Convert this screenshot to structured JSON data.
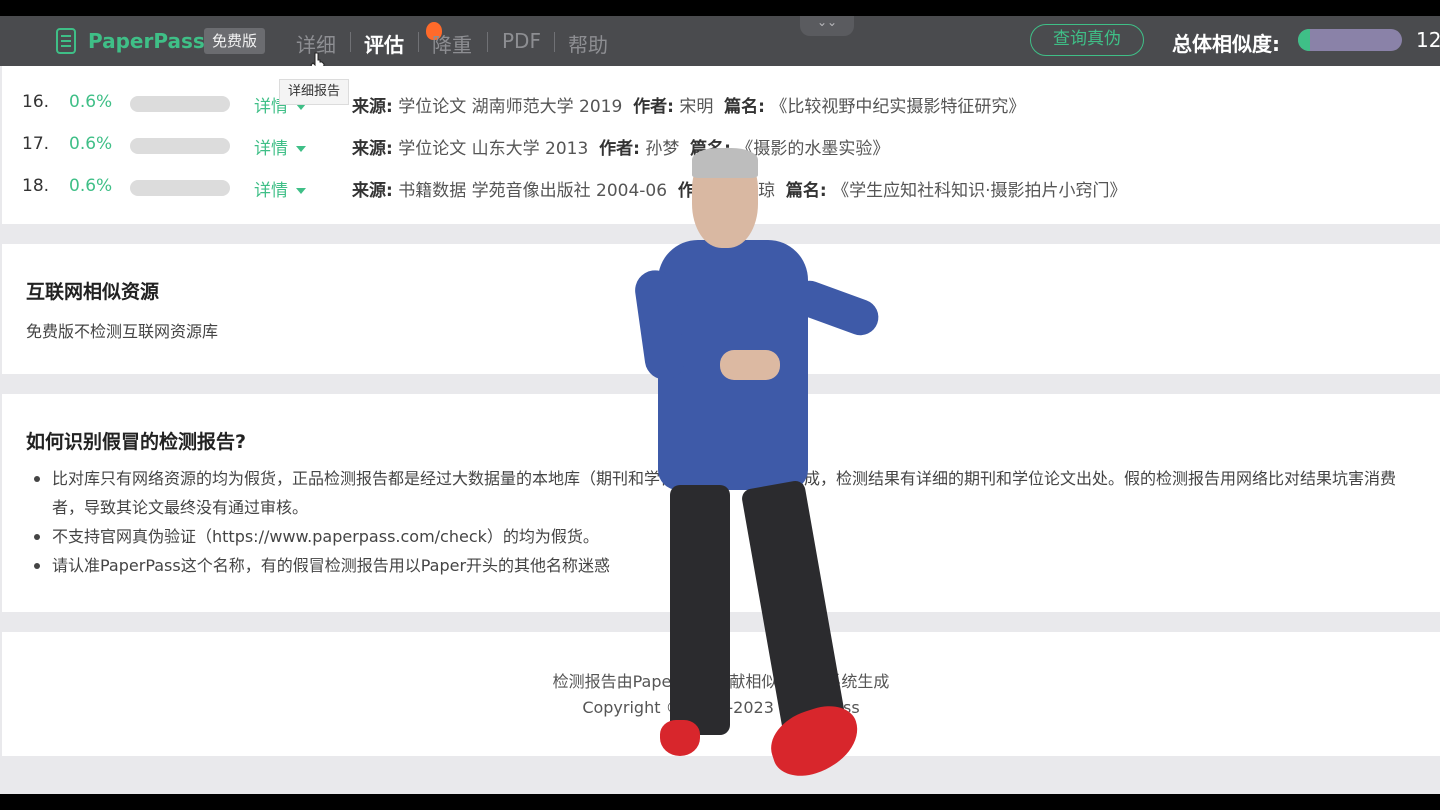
{
  "topbar": {
    "brand": "PaperPass",
    "badge": "免费版",
    "nav": [
      "详细",
      "评估",
      "降重",
      "PDF",
      "帮助"
    ],
    "verify_button": "查询真伪",
    "similarity_label": "总体相似度:",
    "similarity_value": "12",
    "similarity_fill": 0.12,
    "tooltip": "详细报告"
  },
  "list": {
    "detail_label": "详情",
    "source_label": "来源:",
    "author_label": "作者:",
    "title_label": "篇名:",
    "rows": [
      {
        "num": "16.",
        "pct": "0.6%",
        "source": "学位论文 湖南师范大学 2019",
        "author": "宋明",
        "title": "《比较视野中纪实摄影特征研究》"
      },
      {
        "num": "17.",
        "pct": "0.6%",
        "source": "学位论文 山东大学 2013",
        "author": "孙梦",
        "title": "《摄影的水墨实验》"
      },
      {
        "num": "18.",
        "pct": "0.6%",
        "source": "书籍数据 学苑音像出版社 2004-06",
        "author": "周丽琼",
        "title": "《学生应知社科知识·摄影拍片小窍门》"
      }
    ]
  },
  "internet": {
    "heading": "互联网相似资源",
    "text": "免费版不检测互联网资源库"
  },
  "fake": {
    "heading": "如何识别假冒的检测报告?",
    "bullets": [
      "比对库只有网络资源的均为假货，正品检测报告都是经过大数据量的本地库（期刊和学位论文）详细比对生成，检测结果有详细的期刊和学位论文出处。假的检测报告用网络比对结果坑害消费者，导致其论文最终没有通过审核。",
      "不支持官网真伪验证（https://www.paperpass.com/check）的均为假货。",
      "请认准PaperPass这个名称，有的假冒检测报告用以Paper开头的其他名称迷惑"
    ]
  },
  "footer": {
    "line1": "检测报告由PaperPass文献相似度检测系统生成",
    "line2": "Copyright © 2007-2023 PaperPass"
  },
  "colors": {
    "accent": "#3fbf87",
    "topbar": "#4a4b4e",
    "background": "#e9e9ec"
  }
}
